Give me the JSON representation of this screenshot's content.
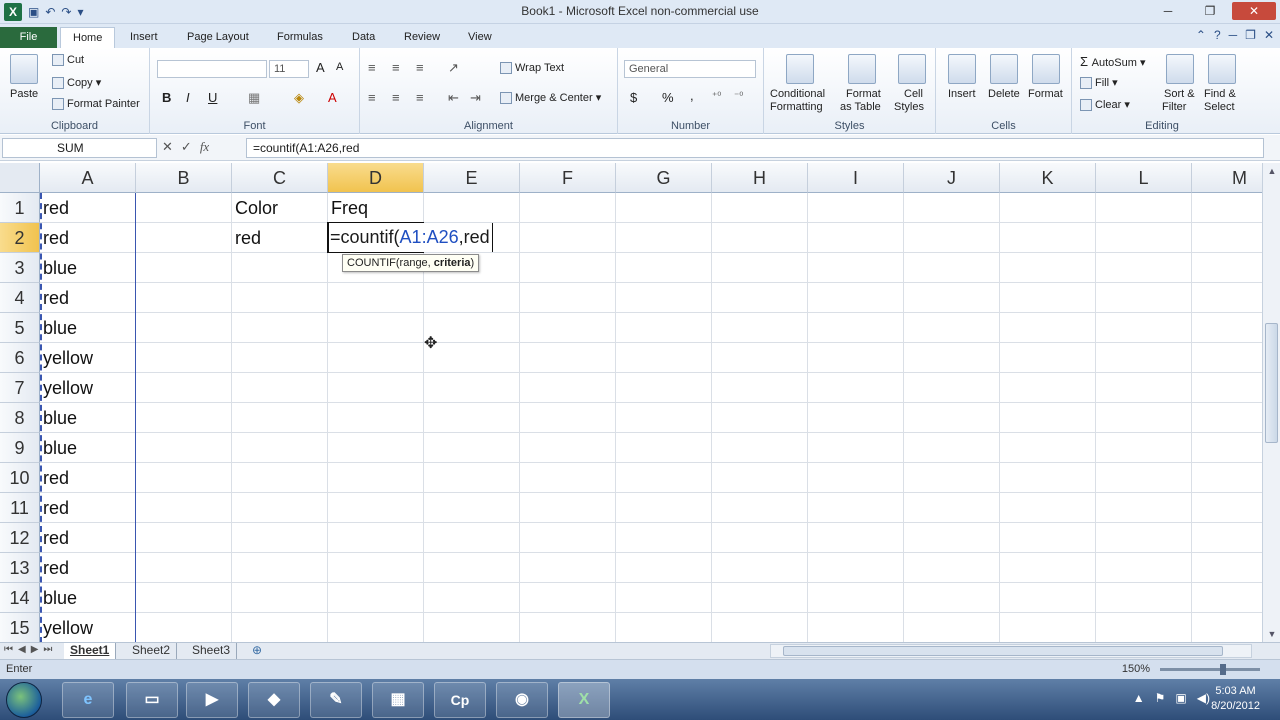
{
  "window": {
    "title": "Book1 - Microsoft Excel non-commercial use",
    "minimize": "─",
    "restore": "❐",
    "close": "✕"
  },
  "tabs": {
    "file": "File",
    "items": [
      "Home",
      "Insert",
      "Page Layout",
      "Formulas",
      "Data",
      "Review",
      "View"
    ]
  },
  "ribbon": {
    "clipboard": {
      "paste": "Paste",
      "cut": "Cut",
      "copy": "Copy",
      "format_painter": "Format Painter",
      "label": "Clipboard"
    },
    "font": {
      "font_size": "11",
      "bold": "B",
      "italic": "I",
      "underline": "U",
      "label": "Font"
    },
    "alignment": {
      "wrap_text": "Wrap Text",
      "merge_center": "Merge & Center",
      "label": "Alignment"
    },
    "number": {
      "format": "General",
      "dollar": "$",
      "percent": "%",
      "comma": ",",
      "label": "Number"
    },
    "styles": {
      "conditional_1": "Conditional",
      "conditional_2": "Formatting",
      "format_table_1": "Format",
      "format_table_2": "as Table",
      "cell_styles_1": "Cell",
      "cell_styles_2": "Styles",
      "label": "Styles"
    },
    "cells": {
      "insert": "Insert",
      "delete": "Delete",
      "format": "Format",
      "label": "Cells"
    },
    "editing": {
      "autosum": "AutoSum",
      "fill": "Fill",
      "clear": "Clear",
      "sort_1": "Sort &",
      "sort_2": "Filter",
      "find_1": "Find &",
      "find_2": "Select",
      "label": "Editing"
    }
  },
  "formula_bar": {
    "name_box": "SUM",
    "cancel": "✕",
    "enter": "✓",
    "fx": "fx",
    "formula": "=countif(A1:A26,red"
  },
  "columns": [
    "A",
    "B",
    "C",
    "D",
    "E",
    "F",
    "G",
    "H",
    "I",
    "J",
    "K",
    "L",
    "M"
  ],
  "rows": [
    "1",
    "2",
    "3",
    "4",
    "5",
    "6",
    "7",
    "8",
    "9",
    "10",
    "11",
    "12",
    "13",
    "14",
    "15"
  ],
  "column_a": [
    "red",
    "red",
    "blue",
    "red",
    "blue",
    "yellow",
    "yellow",
    "blue",
    "blue",
    "red",
    "red",
    "red",
    "red",
    "blue",
    "yellow"
  ],
  "cells": {
    "c1": "Color",
    "d1": "Freq",
    "c2": "red"
  },
  "edit": {
    "prefix": "=countif(",
    "range": "A1:A26",
    "suffix": ",red",
    "tooltip_fn": "COUNTIF(range, ",
    "tooltip_arg": "criteria",
    "tooltip_end": ")"
  },
  "sheets": [
    "Sheet1",
    "Sheet2",
    "Sheet3"
  ],
  "status": {
    "mode": "Enter",
    "zoom": "150%"
  },
  "taskbar": {
    "time": "5:03 AM",
    "date": "8/20/2012"
  }
}
